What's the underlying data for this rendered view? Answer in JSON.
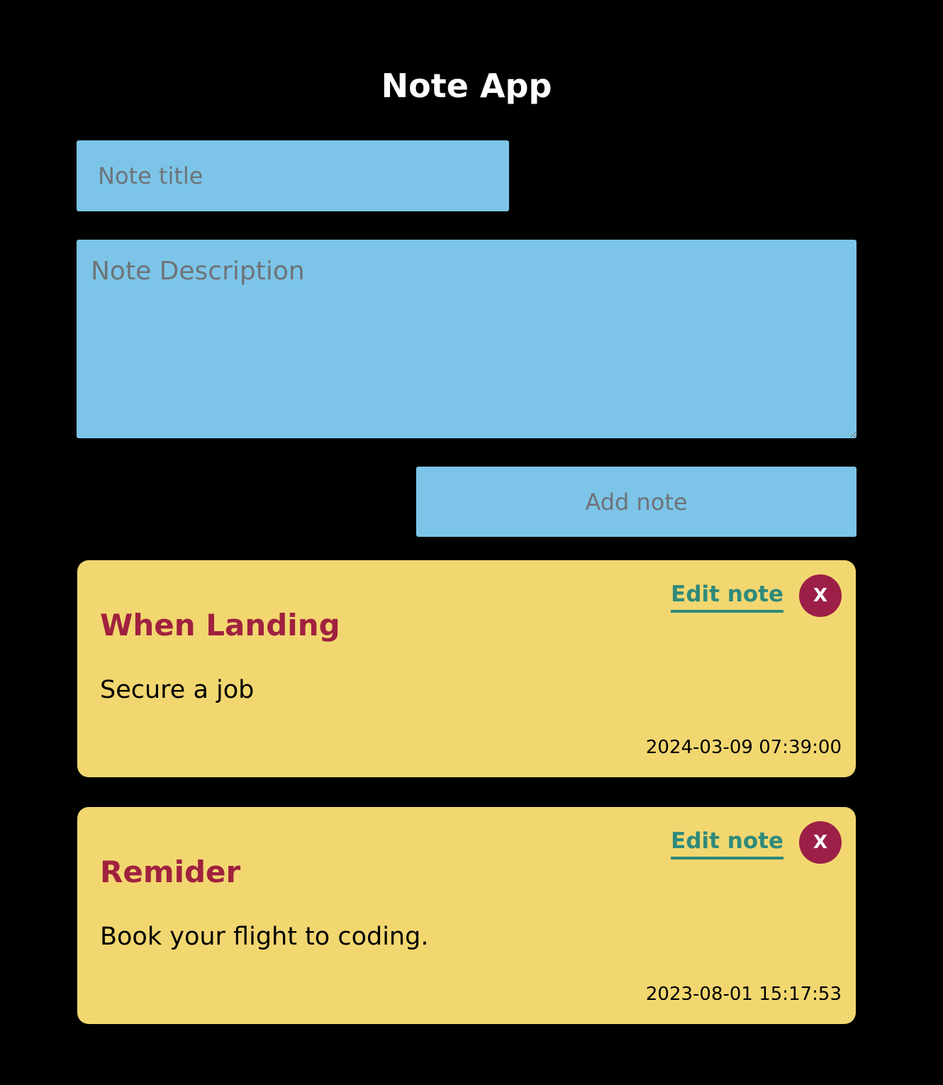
{
  "app": {
    "title": "Note App"
  },
  "form": {
    "title_placeholder": "Note title",
    "title_value": "",
    "description_placeholder": "Note Description",
    "description_value": "",
    "add_button_label": "Add note"
  },
  "notes": [
    {
      "title": "When Landing",
      "description": "Secure a job",
      "date": "2024-03-09 07:39:00",
      "edit_label": "Edit note",
      "delete_label": "X"
    },
    {
      "title": "Remider",
      "description": "Book your flight to coding.",
      "date": "2023-08-01 15:17:53",
      "edit_label": "Edit note",
      "delete_label": "X"
    }
  ],
  "colors": {
    "background": "#000000",
    "input_background": "#7cc5e8",
    "card_background": "#f2d770",
    "note_title": "#a0213f",
    "edit_link": "#2e8a7c",
    "delete_button": "#9c1f47"
  }
}
